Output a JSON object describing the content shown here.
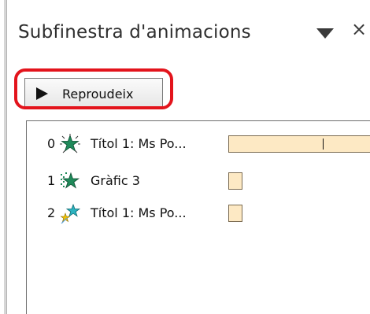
{
  "pane": {
    "title": "Subfinestra d'animacions",
    "dropdown_icon": "triangle-down-icon",
    "close_symbol": "×"
  },
  "toolbar": {
    "play_label": "Reproudeix",
    "play_icon": "play-triangle-icon",
    "highlight_color": "#e3141c"
  },
  "animation_list": {
    "items": [
      {
        "index": "0",
        "label": "Títol 1: Ms Po...",
        "icon": "star-burst-effect-icon",
        "bar_kind": "long"
      },
      {
        "index": "1",
        "label": "Gràfic 3",
        "icon": "star-dissolve-effect-icon",
        "bar_kind": "short"
      },
      {
        "index": "2",
        "label": "Títol 1: Ms Po...",
        "icon": "star-fly-in-effect-icon",
        "bar_kind": "short"
      }
    ]
  },
  "colors": {
    "timing_bar_fill": "#fde9c4",
    "star_green": "#1f8a5a",
    "star_teal": "#2bb3c0"
  }
}
